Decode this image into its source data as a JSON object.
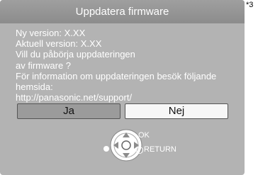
{
  "dialog": {
    "title": "Uppdatera firmware",
    "lines": [
      "Ny version: X.XX",
      "Aktuell version: X.XX",
      "Vill du påbörja uppdateringen",
      "av firmware ?",
      "För information om uppdateringen besök följande",
      "hemsida:",
      "http://panasonic.net/support/"
    ],
    "buttons": {
      "yes_label": "Ja",
      "no_label": "Nej"
    },
    "hints": {
      "ok_label": "OK",
      "return_label": "RETURN"
    }
  },
  "footnote": "*3",
  "colors": {
    "dialog_bg": "#b3b3b3",
    "title_bar": "#8f8f8f",
    "selected_button": "#f7f7f7",
    "unselected_button": "#9b9b9b"
  }
}
